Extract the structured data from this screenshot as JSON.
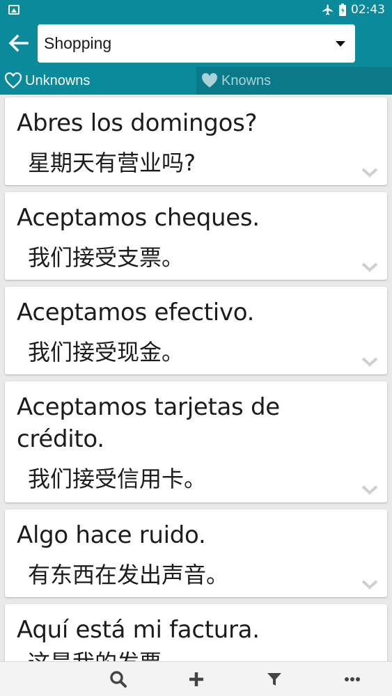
{
  "status_bar": {
    "time": "02:43"
  },
  "header": {
    "category": "Shopping"
  },
  "tabs": [
    {
      "label": "Unknowns"
    },
    {
      "label": "Knowns"
    }
  ],
  "phrases": [
    {
      "es": "Abres los domingos?",
      "zh": "星期天有营业吗?"
    },
    {
      "es": "Aceptamos cheques.",
      "zh": "我们接受支票。"
    },
    {
      "es": "Aceptamos efectivo.",
      "zh": "我们接受现金。"
    },
    {
      "es": "Aceptamos tarjetas de crédito.",
      "zh": "我们接受信用卡。"
    },
    {
      "es": "Algo hace ruido.",
      "zh": "有东西在发出声音。"
    },
    {
      "es": "Aquí está mi factura.",
      "zh": "这是我的发票。"
    }
  ],
  "colors": {
    "primary": "#0b8a9c",
    "tab_inactive": "#0a7a89"
  },
  "icons": {
    "back": "arrow-left-icon",
    "dropdown": "caret-down-icon",
    "unknowns": "heart-outline-icon",
    "knowns": "heart-filled-icon",
    "expand": "chevron-down-icon",
    "toolbar": [
      "search-icon",
      "plus-icon",
      "filter-icon",
      "more-icon"
    ]
  }
}
